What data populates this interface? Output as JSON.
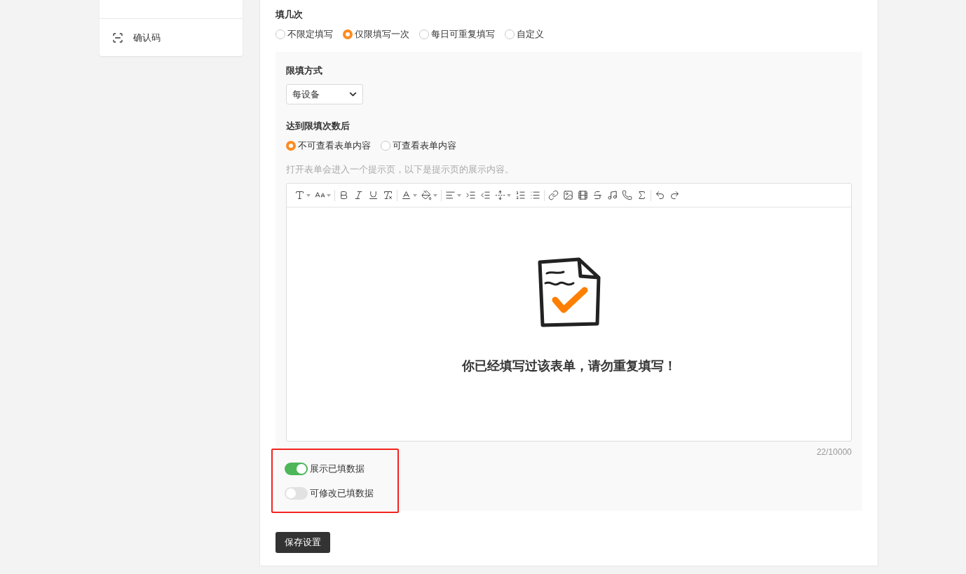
{
  "sidebar": {
    "items": [
      {
        "label": "确认码"
      }
    ]
  },
  "fill_times": {
    "label": "填几次",
    "options": [
      {
        "label": "不限定填写",
        "selected": false
      },
      {
        "label": "仅限填写一次",
        "selected": true
      },
      {
        "label": "每日可重复填写",
        "selected": false
      },
      {
        "label": "自定义",
        "selected": false
      }
    ]
  },
  "limit_panel": {
    "method": {
      "label": "限填方式",
      "value": "每设备"
    },
    "after_limit": {
      "label": "达到限填次数后",
      "options": [
        {
          "label": "不可查看表单内容",
          "selected": true
        },
        {
          "label": "可查看表单内容",
          "selected": false
        }
      ]
    },
    "hint": "打开表单会进入一个提示页，以下是提示页的展示内容。",
    "editor": {
      "message": "你已经填写过该表单，请勿重复填写！",
      "counter": "22/10000"
    },
    "toggles": [
      {
        "label": "展示已填数据",
        "on": true
      },
      {
        "label": "可修改已填数据",
        "on": false
      }
    ]
  },
  "save_button": "保存设置"
}
